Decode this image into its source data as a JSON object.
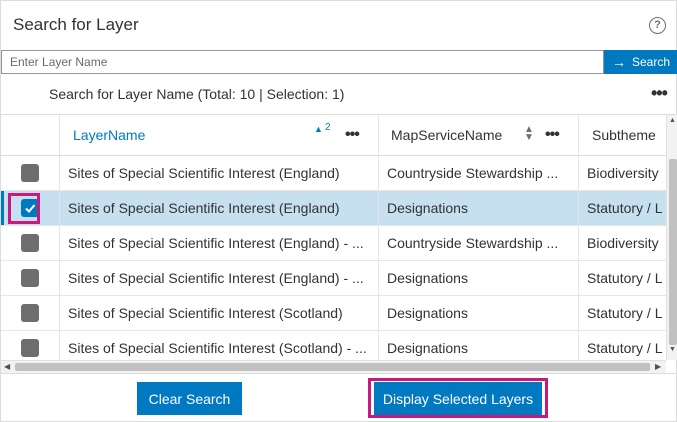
{
  "panel": {
    "title": "Search for Layer",
    "help_icon": "?"
  },
  "search": {
    "placeholder": "Enter Layer Name",
    "value": "",
    "button_label": "Search",
    "button_icon": "→"
  },
  "summary": "Search for Layer Name (Total: 10 | Selection: 1)",
  "more_icon": "•••",
  "grid": {
    "columns": [
      {
        "label": "LayerName",
        "sort": "ascending",
        "sort_order": "2"
      },
      {
        "label": "MapServiceName",
        "sort": "none"
      },
      {
        "label": "Subtheme"
      }
    ],
    "rows": [
      {
        "checked": false,
        "layer": "Sites of Special Scientific Interest (England)",
        "service": "Countryside Stewardship ...",
        "subtheme": "Biodiversity"
      },
      {
        "checked": true,
        "layer": "Sites of Special Scientific Interest (England)",
        "service": "Designations",
        "subtheme": "Statutory / L"
      },
      {
        "checked": false,
        "layer": "Sites of Special Scientific Interest (England) - ...",
        "service": "Countryside Stewardship ...",
        "subtheme": "Biodiversity"
      },
      {
        "checked": false,
        "layer": "Sites of Special Scientific Interest (England) - ...",
        "service": "Designations",
        "subtheme": "Statutory / L"
      },
      {
        "checked": false,
        "layer": "Sites of Special Scientific Interest (Scotland)",
        "service": "Designations",
        "subtheme": "Statutory / L"
      },
      {
        "checked": false,
        "layer": "Sites of Special Scientific Interest (Scotland) - ...",
        "service": "Designations",
        "subtheme": "Statutory / L"
      }
    ]
  },
  "footer": {
    "clear_label": "Clear Search",
    "display_label": "Display Selected Layers"
  },
  "colors": {
    "accent": "#0079c1",
    "selected_row": "#c7e0f0",
    "highlight": "#c61a7e"
  }
}
